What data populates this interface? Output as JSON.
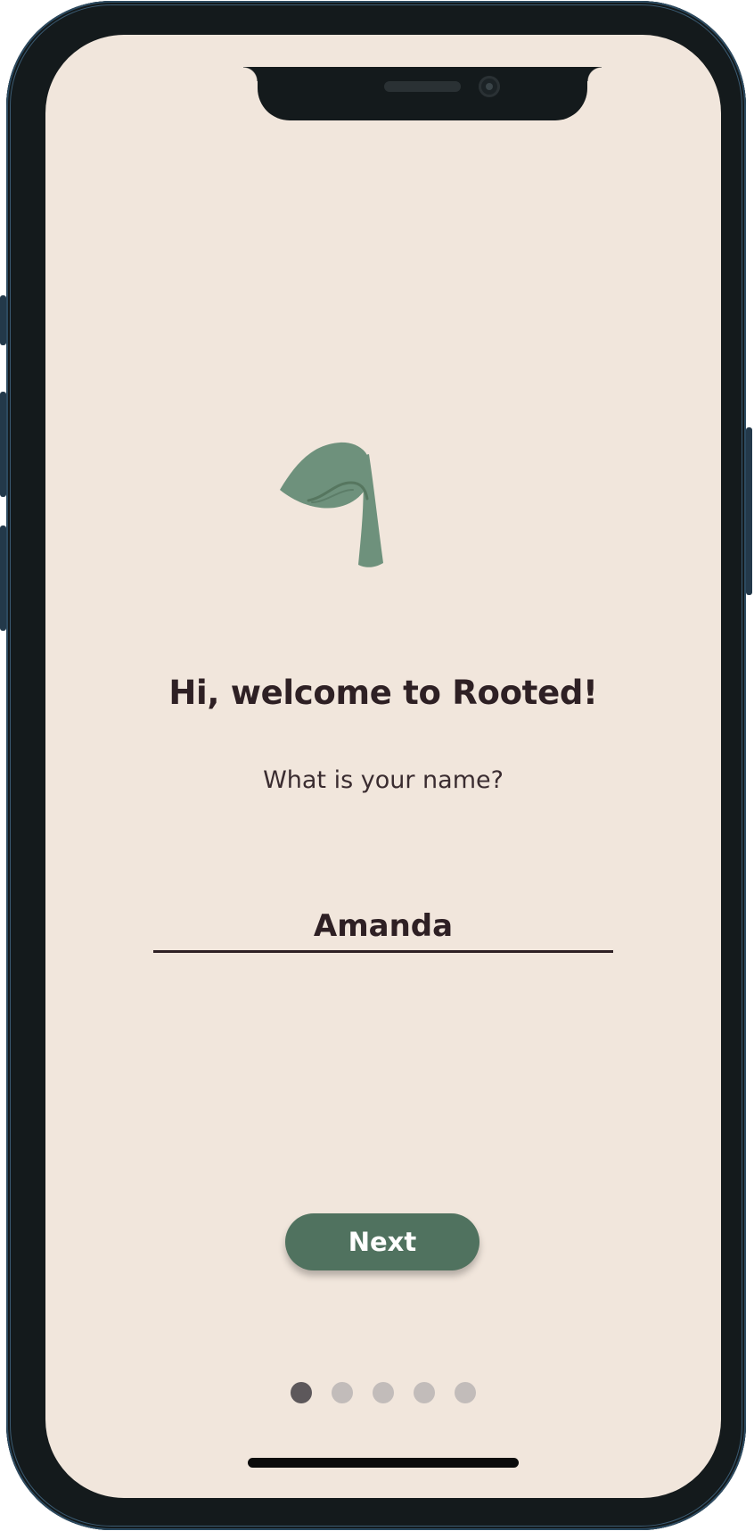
{
  "app": {
    "name": "Rooted",
    "logo_icon": "leaf-sprout-icon",
    "accent_color": "#50725f",
    "background_color": "#f1e6dc"
  },
  "onboarding": {
    "title": "Hi, welcome to Rooted!",
    "question": "What is your name?",
    "name_value": "Amanda",
    "next_label": "Next",
    "current_step": 1,
    "total_steps": 5
  }
}
